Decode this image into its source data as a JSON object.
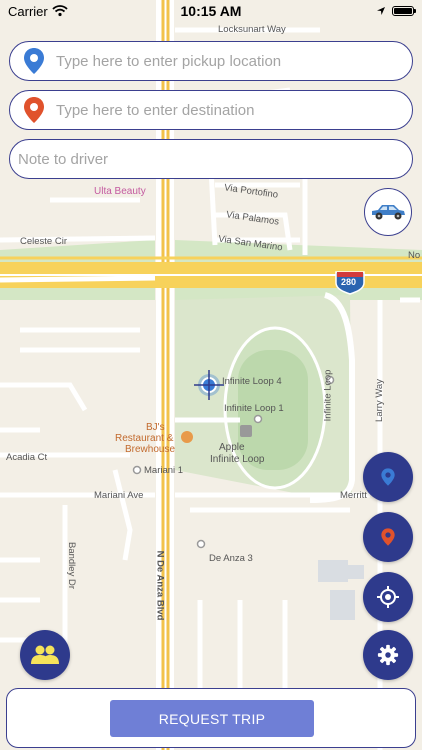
{
  "status_bar": {
    "carrier": "Carrier",
    "time": "10:15 AM"
  },
  "inputs": {
    "pickup_placeholder": "Type here to enter pickup location",
    "destination_placeholder": "Type here to enter destination",
    "note_placeholder": "Note to driver"
  },
  "map": {
    "labels": {
      "locksunart": "Locksunart Way",
      "ulta": "Ulta Beauty",
      "portofino": "Via Portofino",
      "palamos": "Via Palamos",
      "sanmarino": "Via San Marino",
      "celeste": "Celeste Cir",
      "highway_shield": "280",
      "infinite4": "Infinite Loop 4",
      "infinite1": "Infinite Loop 1",
      "apple_line1": "Apple",
      "apple_line2": "Infinite Loop",
      "bjs_line1": "BJ's",
      "bjs_line2": "Restaurant &",
      "bjs_line3": "Brewhouse",
      "acadia": "Acadia Ct",
      "mariani1": "Mariani 1",
      "mariani_ave": "Mariani Ave",
      "merritt": "Merritt",
      "deanza3": "De Anza 3",
      "deanza_blvd": "N De Anza Blvd",
      "bandley": "Bandley Dr",
      "larry": "Larry Way",
      "infinite_loop_road": "Infinite Loop",
      "no_partial": "No"
    }
  },
  "actions": {
    "request_trip": "REQUEST TRIP"
  },
  "colors": {
    "accent": "#2e3a8c",
    "border": "#3b3f8f",
    "button": "#6f7fd6",
    "pickup_pin": "#3a7bd5",
    "destination_pin": "#e0522c"
  },
  "icons": {
    "pickup": "location-pin-icon",
    "destination": "location-pin-icon",
    "car": "car-icon",
    "group": "group-icon",
    "locate": "crosshair-icon",
    "settings": "gear-icon"
  }
}
